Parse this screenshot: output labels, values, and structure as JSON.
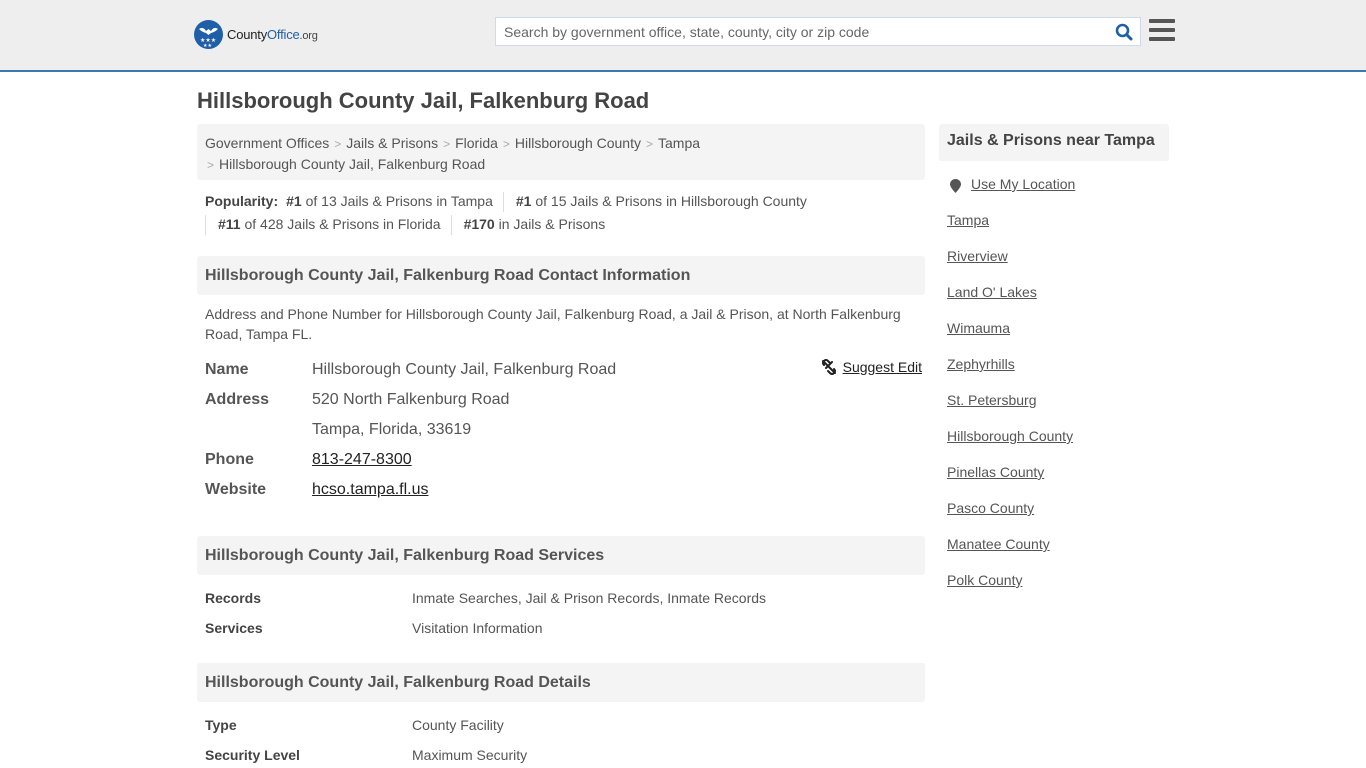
{
  "header": {
    "logo": {
      "county": "County",
      "office": "Office",
      "org": ".org"
    },
    "search_placeholder": "Search by government office, state, county, city or zip code",
    "search_icon": "search-icon",
    "menu_icon": "hamburger-menu-icon"
  },
  "page_title": "Hillsborough County Jail, Falkenburg Road",
  "breadcrumb": [
    "Government Offices",
    "Jails & Prisons",
    "Florida",
    "Hillsborough County",
    "Tampa",
    "Hillsborough County Jail, Falkenburg Road"
  ],
  "popularity": {
    "label": "Popularity:",
    "items": [
      {
        "rank": "#1",
        "text": " of 13 Jails & Prisons in Tampa"
      },
      {
        "rank": "#1",
        "text": " of 15 Jails & Prisons in Hillsborough County"
      },
      {
        "rank": "#11",
        "text": " of 428 Jails & Prisons in Florida"
      },
      {
        "rank": "#170",
        "text": " in Jails & Prisons"
      }
    ]
  },
  "contact": {
    "heading": "Hillsborough County Jail, Falkenburg Road Contact Information",
    "description": "Address and Phone Number for Hillsborough County Jail, Falkenburg Road, a Jail & Prison, at North Falkenburg Road, Tampa FL.",
    "suggest_edit": "Suggest Edit",
    "rows": {
      "name_label": "Name",
      "name": "Hillsborough County Jail, Falkenburg Road",
      "address_label": "Address",
      "address_line1": "520 North Falkenburg Road",
      "address_line2": "Tampa, Florida, 33619",
      "phone_label": "Phone",
      "phone": "813-247-8300",
      "website_label": "Website",
      "website": "hcso.tampa.fl.us"
    }
  },
  "services": {
    "heading": "Hillsborough County Jail, Falkenburg Road Services",
    "rows": [
      {
        "label": "Records",
        "value": "Inmate Searches, Jail & Prison Records, Inmate Records"
      },
      {
        "label": "Services",
        "value": "Visitation Information"
      }
    ]
  },
  "details": {
    "heading": "Hillsborough County Jail, Falkenburg Road Details",
    "rows": [
      {
        "label": "Type",
        "value": "County Facility"
      },
      {
        "label": "Security Level",
        "value": "Maximum Security"
      }
    ]
  },
  "sidebar": {
    "heading": "Jails & Prisons near Tampa",
    "use_location": "Use My Location",
    "links": [
      "Tampa",
      "Riverview",
      "Land O' Lakes",
      "Wimauma",
      "Zephyrhills",
      "St. Petersburg",
      "Hillsborough County",
      "Pinellas County",
      "Pasco County",
      "Manatee County",
      "Polk County"
    ]
  },
  "colors": {
    "brand": "#1f5fa8",
    "header_border": "#3a7aa8",
    "panel_bg": "#f4f4f4"
  }
}
